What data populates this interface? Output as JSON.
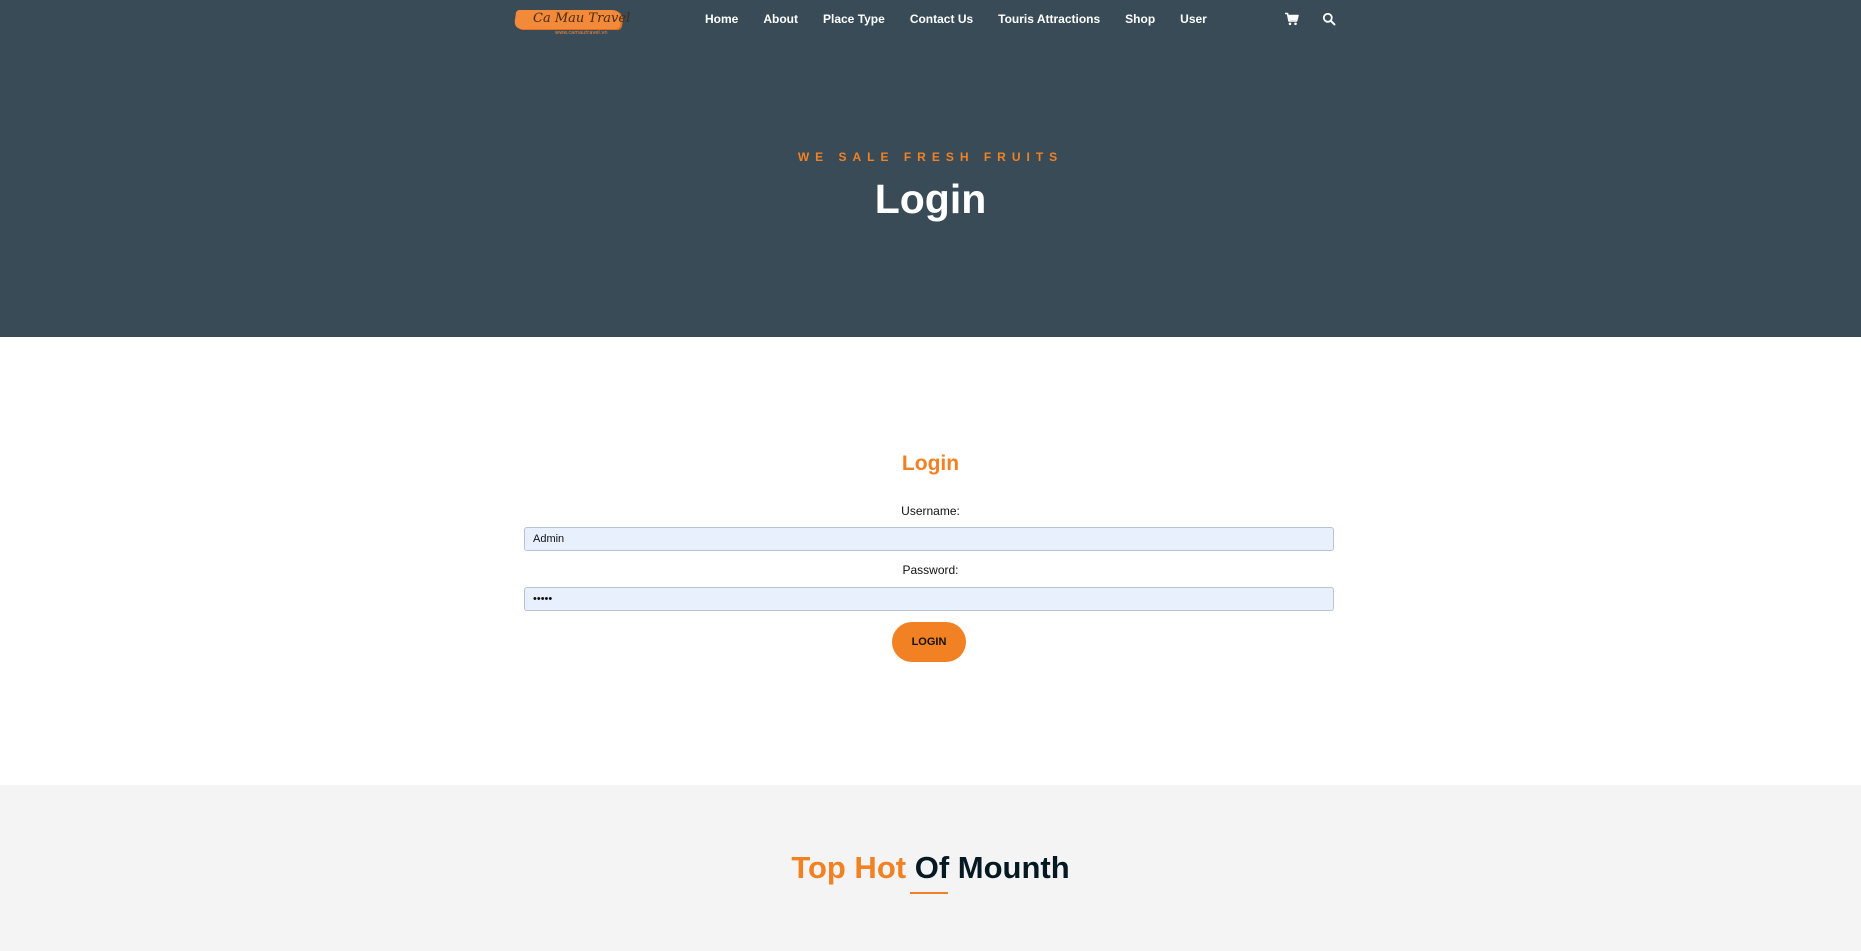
{
  "brand": {
    "logo_text": "Ca Mau Travel",
    "logo_subtext": "www.camautravel.vn",
    "accent_color": "#f28123",
    "hero_bg_color": "#384b57"
  },
  "nav": {
    "items": [
      {
        "label": "Home"
      },
      {
        "label": "About"
      },
      {
        "label": "Place Type"
      },
      {
        "label": "Contact Us"
      },
      {
        "label": "Touris Attractions"
      },
      {
        "label": "Shop"
      },
      {
        "label": "User"
      }
    ],
    "icons": [
      "cart-icon",
      "search-icon"
    ]
  },
  "hero": {
    "eyebrow": "WE SALE FRESH FRUITS",
    "title": "Login"
  },
  "login_form": {
    "title": "Login",
    "username_label": "Username:",
    "username_value": "Admin",
    "password_label": "Password:",
    "password_value": "•••••",
    "submit_label": "LOGIN"
  },
  "top_section": {
    "title_highlight": "Top Hot",
    "title_rest": "Of Mounth"
  }
}
